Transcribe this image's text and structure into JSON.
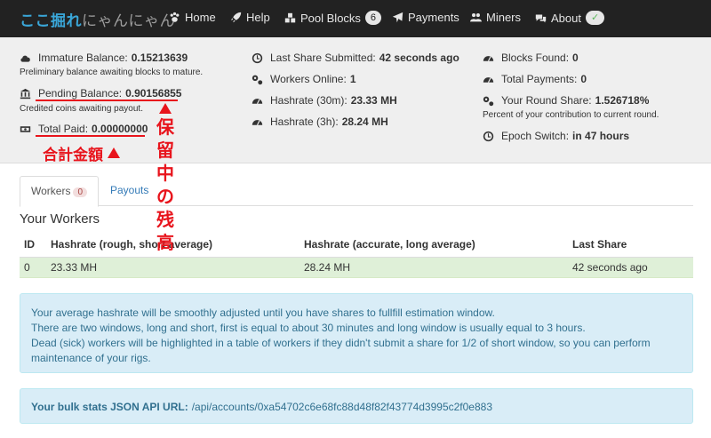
{
  "brand": {
    "highlight": "ここ掘れ",
    "rest": "にゃんにゃん"
  },
  "nav": [
    {
      "label": "Home",
      "icon": "paw-icon"
    },
    {
      "label": "Help",
      "icon": "rocket-icon"
    },
    {
      "label": "Pool Blocks",
      "icon": "cubes-icon",
      "badge": "6"
    },
    {
      "label": "Payments",
      "icon": "paper-plane-icon"
    },
    {
      "label": "Miners",
      "icon": "users-icon"
    },
    {
      "label": "About",
      "icon": "comments-icon",
      "badge": "✓"
    }
  ],
  "stats": {
    "immature_label": "Immature Balance:",
    "immature_value": "0.15213639",
    "immature_sub": "Preliminary balance awaiting blocks to mature.",
    "pending_label": "Pending Balance:",
    "pending_value": "0.90156855",
    "pending_sub": "Credited coins awaiting payout.",
    "paid_label": "Total Paid:",
    "paid_value": "0.00000000",
    "last_share_label": "Last Share Submitted:",
    "last_share_value": "42 seconds ago",
    "workers_label": "Workers Online:",
    "workers_value": "1",
    "hr30_label": "Hashrate (30m):",
    "hr30_value": "23.33 MH",
    "hr3h_label": "Hashrate (3h):",
    "hr3h_value": "28.24 MH",
    "blocks_label": "Blocks Found:",
    "blocks_value": "0",
    "payments_label": "Total Payments:",
    "payments_value": "0",
    "round_label": "Your Round Share:",
    "round_value": "1.526718%",
    "round_sub": "Percent of your contribution to current round.",
    "epoch_label": "Epoch Switch:",
    "epoch_value": "in 47 hours"
  },
  "annotations": {
    "total_label": "合計金額",
    "pending_vertical": [
      "保",
      "留",
      "中",
      "の",
      "残",
      "高"
    ],
    "color": "#e8141c"
  },
  "tabs": [
    {
      "label": "Workers",
      "count": "0"
    },
    {
      "label": "Payouts"
    }
  ],
  "section_title": "Your Workers",
  "table": {
    "headers": [
      "ID",
      "Hashrate (rough, short average)",
      "Hashrate (accurate, long average)",
      "Last Share"
    ],
    "rows": [
      [
        "0",
        "23.33 MH",
        "28.24 MH",
        "42 seconds ago"
      ]
    ]
  },
  "info": {
    "line1": "Your average hashrate will be smoothly adjusted until you have shares to fullfill estimation window.",
    "line2": "There are two windows, long and short, first is equal to about 30 minutes and long window is usually equal to 3 hours.",
    "line3": "Dead (sick) workers will be highlighted in a table of workers if they didn't submit a share for 1/2 of short window, so you can perform maintenance of your rigs."
  },
  "api": {
    "label": "Your bulk stats JSON API URL:",
    "url": "/api/accounts/0xa54702c6e68fc88d48f82f43774d3995c2f0e883"
  }
}
